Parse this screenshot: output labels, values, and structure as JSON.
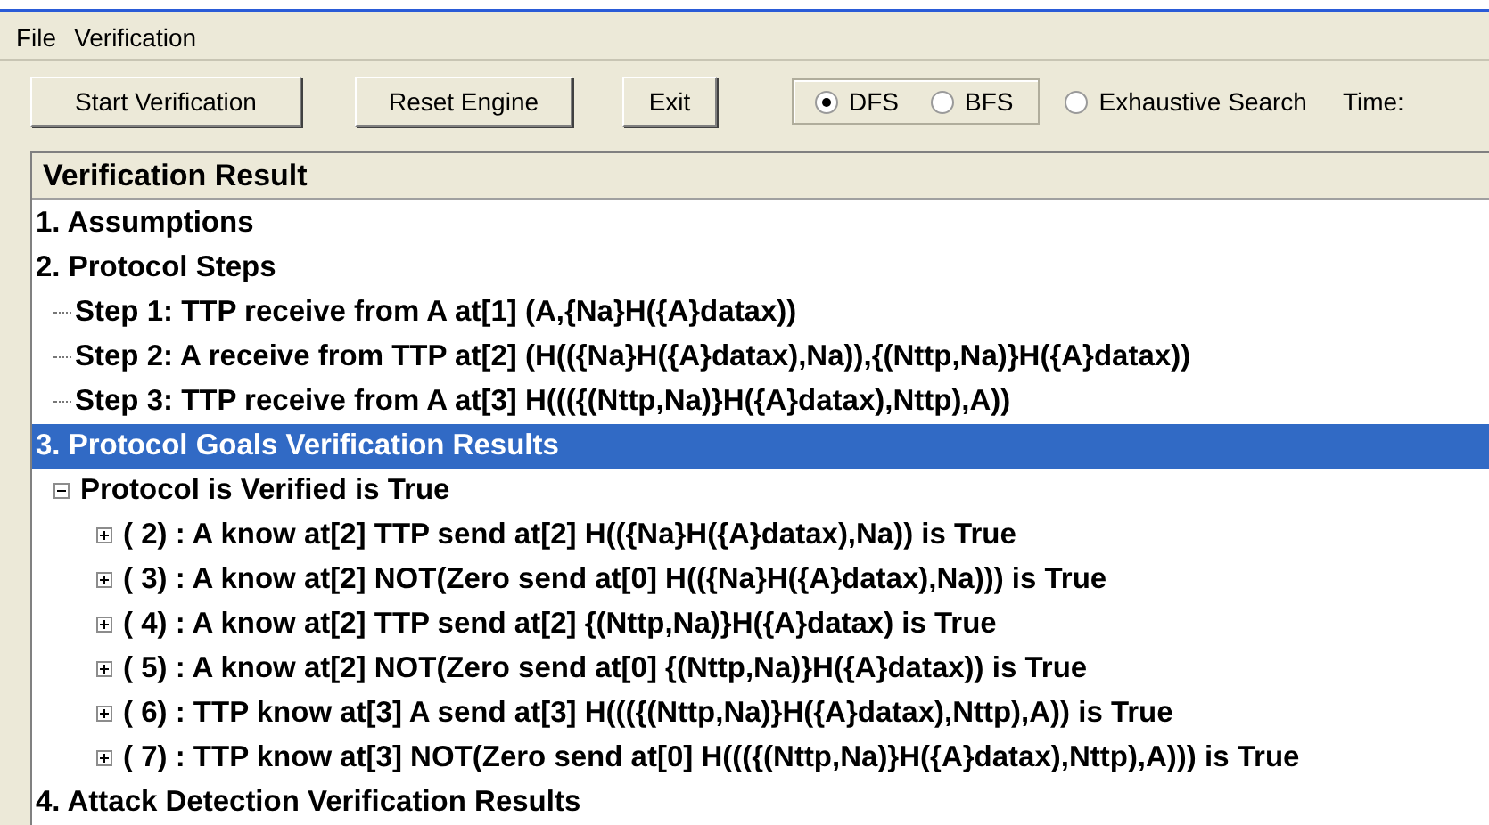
{
  "menu": [
    "File",
    "Verification"
  ],
  "toolbar": {
    "buttons": [
      "Start Verification",
      "Reset Engine",
      "Exit"
    ],
    "search_mode": [
      {
        "label": "DFS",
        "selected": true
      },
      {
        "label": "BFS",
        "selected": false
      }
    ],
    "exhaustive": {
      "label": "Exhaustive Search",
      "selected": false
    },
    "time_label": "Time:"
  },
  "panel": {
    "title": "Verification Result",
    "tree": [
      {
        "label": "1. Assumptions",
        "selected": false
      },
      {
        "label": "2. Protocol Steps",
        "selected": false,
        "children": [
          {
            "label": "Step 1: TTP receive from A at[1] (A,{Na}H({A}datax))",
            "selected": false
          },
          {
            "label": "Step 2: A receive from TTP at[2] (H(({Na}H({A}datax),Na)),{(Nttp,Na)}H({A}datax))",
            "selected": false
          },
          {
            "label": "Step 3: TTP receive from A at[3] H((({(Nttp,Na)}H({A}datax),Nttp),A))",
            "selected": false
          }
        ]
      },
      {
        "label": "3. Protocol Goals Verification Results",
        "selected": true,
        "children": [
          {
            "label": "Protocol is Verified is True",
            "selected": false,
            "expanded": true,
            "children": [
              {
                "label": "( 2) : A know at[2] TTP send at[2] H(({Na}H({A}datax),Na)) is True",
                "selected": false,
                "expanded": false
              },
              {
                "label": "( 3) : A know at[2] NOT(Zero send at[0] H(({Na}H({A}datax),Na))) is True",
                "selected": false,
                "expanded": false
              },
              {
                "label": "( 4) : A know at[2] TTP send at[2] {(Nttp,Na)}H({A}datax) is True",
                "selected": false,
                "expanded": false
              },
              {
                "label": "( 5) : A know at[2] NOT(Zero send at[0] {(Nttp,Na)}H({A}datax)) is True",
                "selected": false,
                "expanded": false
              },
              {
                "label": "( 6) : TTP know at[3] A send at[3] H((({(Nttp,Na)}H({A}datax),Nttp),A)) is True",
                "selected": false,
                "expanded": false
              },
              {
                "label": "( 7) : TTP know at[3] NOT(Zero send at[0] H((({(Nttp,Na)}H({A}datax),Nttp),A))) is True",
                "selected": false,
                "expanded": false
              }
            ]
          }
        ]
      },
      {
        "label": "4. Attack Detection Verification Results",
        "selected": false
      }
    ]
  }
}
